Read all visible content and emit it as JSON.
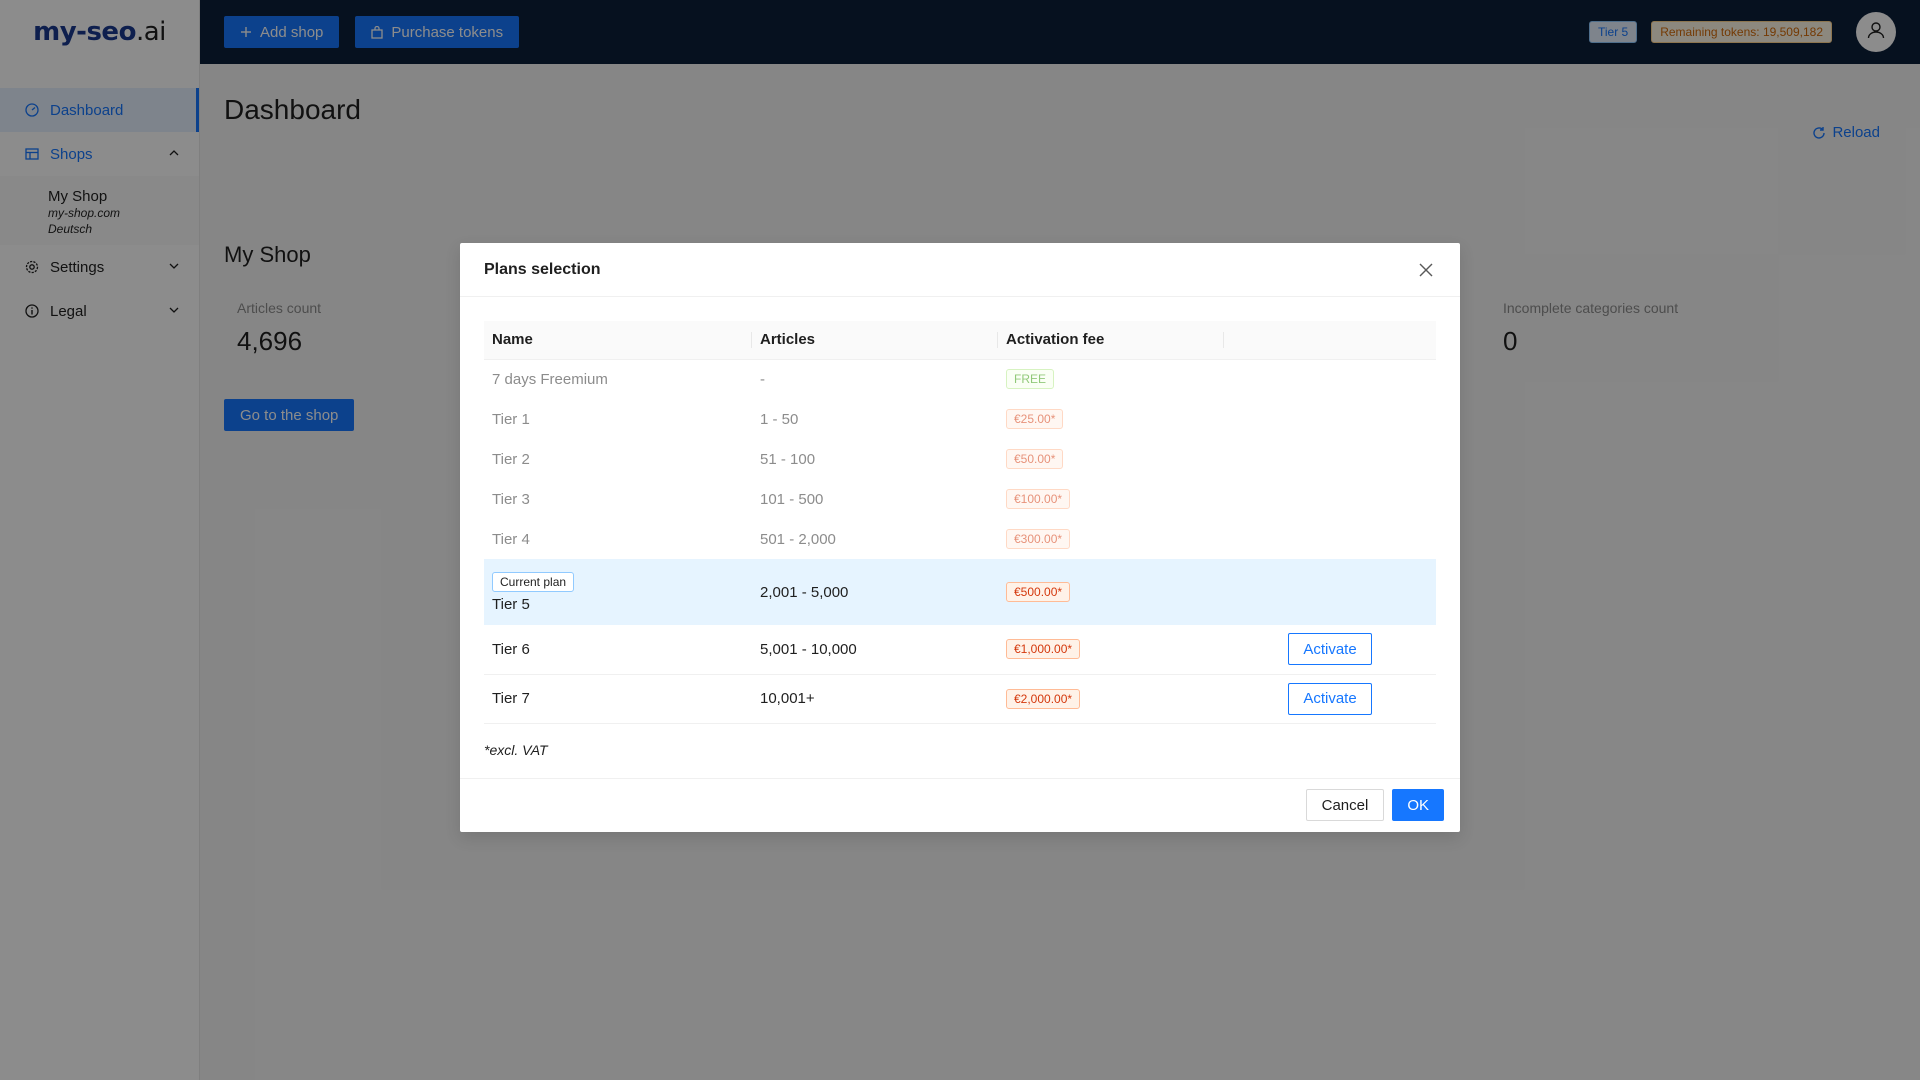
{
  "app": {
    "logo_text": "my-seo",
    "logo_suffix": ".ai"
  },
  "topbar": {
    "add_shop_label": "Add shop",
    "purchase_tokens_label": "Purchase tokens",
    "tier_badge": "Tier 5",
    "tokens_badge": "Remaining tokens: 19,509,182",
    "icons": {
      "add": "plus-icon",
      "purchase": "bag-icon",
      "avatar": "user-icon"
    }
  },
  "sidebar": {
    "items": [
      {
        "label": "Dashboard",
        "icon": "dashboard-icon",
        "active": true
      },
      {
        "label": "Shops",
        "icon": "shop-icon",
        "expanded": true
      },
      {
        "label": "Settings",
        "icon": "gear-icon",
        "expanded": false
      },
      {
        "label": "Legal",
        "icon": "info-icon",
        "expanded": false
      }
    ],
    "shop_entry": {
      "name": "My Shop",
      "domain": "my-shop.com",
      "language": "Deutsch"
    }
  },
  "main": {
    "title": "Dashboard",
    "reload_label": "Reload",
    "shop_title": "My Shop",
    "stats": [
      {
        "label": "Articles count",
        "value": "4,696"
      },
      {
        "label": "Incomplete categories count",
        "value": "0"
      }
    ],
    "go_to_shop_label": "Go to the shop"
  },
  "modal": {
    "title": "Plans selection",
    "columns": [
      "Name",
      "Articles",
      "Activation fee"
    ],
    "rows": [
      {
        "name": "7 days Freemium",
        "articles": "-",
        "fee": "FREE"
      },
      {
        "name": "Tier 1",
        "articles": "1 - 50",
        "fee": "€25.00*"
      },
      {
        "name": "Tier 2",
        "articles": "51 - 100",
        "fee": "€50.00*"
      },
      {
        "name": "Tier 3",
        "articles": "101 - 500",
        "fee": "€100.00*"
      },
      {
        "name": "Tier 4",
        "articles": "501 - 2,000",
        "fee": "€300.00*"
      },
      {
        "name": "Tier 5",
        "articles": "2,001 - 5,000",
        "fee": "€500.00*",
        "tag": "Current plan"
      },
      {
        "name": "Tier 6",
        "articles": "5,001 - 10,000",
        "fee": "€1,000.00*",
        "action": "Activate"
      },
      {
        "name": "Tier 7",
        "articles": "10,001+",
        "fee": "€2,000.00*",
        "action": "Activate"
      }
    ],
    "note": "*excl. VAT",
    "cancel_label": "Cancel",
    "ok_label": "OK"
  },
  "colors": {
    "primary": "#1677ff",
    "topbar": "#0b1f3a",
    "overlay": "rgba(0,0,0,0.45)",
    "fee_tag": "#d4380d",
    "free_tag": "#389e0d"
  }
}
